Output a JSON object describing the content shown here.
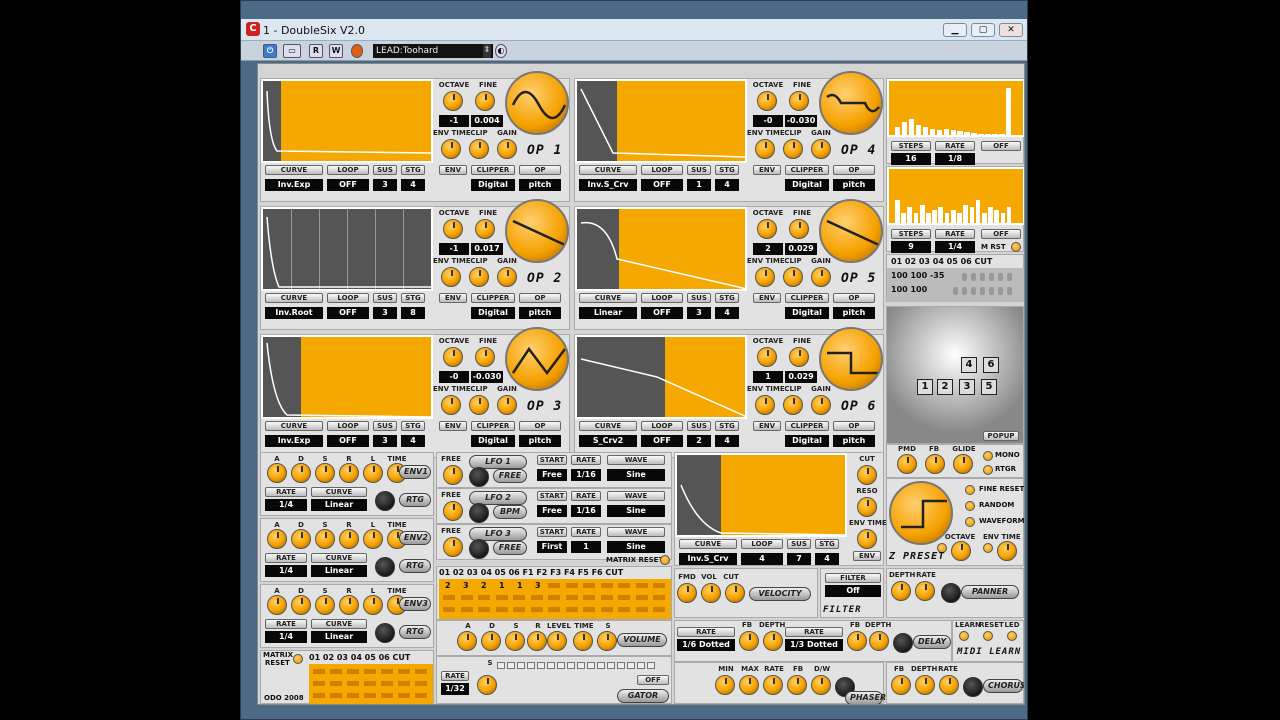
{
  "window": {
    "title": "1 - DoubleSix V2.0",
    "app_icon": "C"
  },
  "toolbar": {
    "preset": "LEAD:Toohard",
    "r": "R",
    "w": "W"
  },
  "ops": [
    {
      "name": "OP 1",
      "octave": "-1",
      "fine": "0.004",
      "curve": "Inv.Exp",
      "loop": "OFF",
      "sus": "3",
      "stg": "4",
      "clipper": "Digital",
      "op": "pitch",
      "wave": "sine"
    },
    {
      "name": "OP 2",
      "octave": "-1",
      "fine": "0.017",
      "curve": "Inv.Root",
      "loop": "OFF",
      "sus": "3",
      "stg": "8",
      "clipper": "Digital",
      "op": "pitch",
      "wave": "saw"
    },
    {
      "name": "OP 3",
      "octave": "-0",
      "fine": "-0.030",
      "curve": "Inv.Exp",
      "loop": "OFF",
      "sus": "3",
      "stg": "4",
      "clipper": "Digital",
      "op": "pitch",
      "wave": "tri"
    },
    {
      "name": "OP 4",
      "octave": "-0",
      "fine": "-0.030",
      "curve": "Inv.S_Crv",
      "loop": "OFF",
      "sus": "1",
      "stg": "4",
      "clipper": "Digital",
      "op": "pitch",
      "wave": "sq-sine"
    },
    {
      "name": "OP 5",
      "octave": "2",
      "fine": "0.029",
      "curve": "Linear",
      "loop": "OFF",
      "sus": "3",
      "stg": "4",
      "clipper": "Digital",
      "op": "pitch",
      "wave": "saw"
    },
    {
      "name": "OP 6",
      "octave": "1",
      "fine": "0.029",
      "curve": "S_Crv2",
      "loop": "OFF",
      "sus": "2",
      "stg": "4",
      "clipper": "Digital",
      "op": "pitch",
      "wave": "square"
    }
  ],
  "op_labels": {
    "octave": "OCTAVE",
    "fine": "FINE",
    "env_time": "ENV TIME",
    "clip": "CLIP",
    "gain": "GAIN",
    "curve": "CURVE",
    "loop": "LOOP",
    "sus": "SUS",
    "stg": "STG",
    "env": "ENV",
    "clipper": "CLIPPER",
    "op": "OP"
  },
  "seq1": {
    "steps_label": "STEPS",
    "rate_label": "RATE",
    "off": "OFF",
    "steps": "16",
    "rate": "1/8",
    "bars": [
      0.15,
      0.25,
      0.3,
      0.2,
      0.15,
      0.12,
      0.1,
      0.12,
      0.1,
      0.08,
      0.05,
      0.03,
      0.02,
      0.02,
      0.02,
      0.02,
      0.9
    ]
  },
  "seq2": {
    "steps_label": "STEPS",
    "rate_label": "RATE",
    "off": "OFF",
    "steps": "9",
    "rate": "1/4",
    "mrst": "M RST",
    "bars": [
      0.45,
      0.2,
      0.3,
      0.2,
      0.35,
      0.2,
      0.25,
      0.3,
      0.2,
      0.25,
      0.2,
      0.35,
      0.3,
      0.45,
      0.2,
      0.3,
      0.25,
      0.2,
      0.3
    ]
  },
  "route": {
    "header": "01 02 03 04 05 06 CUT",
    "row1": "100 100 -35",
    "row2": "100 100"
  },
  "algo": {
    "boxes": [
      "1",
      "2",
      "3",
      "5",
      "4",
      "6"
    ],
    "popup": "POPUP"
  },
  "global": {
    "pmd": "PMD",
    "fb": "FB",
    "glide": "GLIDE",
    "mono": "MONO",
    "rtgr": "RTGR"
  },
  "z": {
    "fine_reset": "FINE RESET",
    "random": "RANDOM",
    "waveform": "WAVEFORM",
    "octave": "OCTAVE",
    "env_time": "ENV TIME",
    "label": "Z PRESET"
  },
  "envs": [
    {
      "label": "ENV1",
      "rate": "1/4",
      "curve": "Linear"
    },
    {
      "label": "ENV2",
      "rate": "1/4",
      "curve": "Linear"
    },
    {
      "label": "ENV3",
      "rate": "1/4",
      "curve": "Linear"
    }
  ],
  "env_labels": {
    "a": "A",
    "d": "D",
    "s": "S",
    "r": "R",
    "l": "L",
    "time": "TIME",
    "rate": "RATE",
    "curve": "CURVE",
    "rtg": "RTG"
  },
  "lfos": [
    {
      "title": "LFO 1",
      "mode": "FREE",
      "start": "Free",
      "rate": "1/16",
      "wave": "Sine"
    },
    {
      "title": "LFO 2",
      "mode": "BPM",
      "start": "Free",
      "rate": "1/16",
      "wave": "Sine"
    },
    {
      "title": "LFO 3",
      "mode": "FREE",
      "start": "First",
      "rate": "1",
      "wave": "Sine"
    }
  ],
  "lfo_labels": {
    "free": "FREE",
    "start": "START",
    "rate": "RATE",
    "wave": "WAVE",
    "matrix_reset": "MATRIX RESET"
  },
  "fenv": {
    "cut": "CUT",
    "reso": "RESO",
    "env_time": "ENV TIME",
    "env": "ENV",
    "curve_label": "CURVE",
    "loop_label": "LOOP",
    "sus_label": "SUS",
    "stg_label": "STG",
    "curve": "Inv.S_Crv",
    "loop": "4",
    "sus": "7",
    "stg": "4"
  },
  "matrix": {
    "header": "01 02 03 04 05 06 F1 F2 F3 F4 F5 F6 CUT",
    "values": [
      "2",
      "3",
      "2",
      "1",
      "1",
      "3"
    ]
  },
  "velocity": {
    "fmd": "FMD",
    "vol": "VOL",
    "cut": "CUT",
    "label": "VELOCITY"
  },
  "filter": {
    "label": "FILTER",
    "value": "Off",
    "tag": "FILTER"
  },
  "panner": {
    "depth": "DEPTH",
    "rate": "RATE",
    "label": "PANNER"
  },
  "volume": {
    "a": "A",
    "d": "D",
    "s": "S",
    "r": "R",
    "level": "LEVEL",
    "time": "TIME",
    "s2": "S",
    "label": "VOLUME"
  },
  "delay": {
    "rate": "RATE",
    "fb": "FB",
    "depth": "DEPTH",
    "rate1": "1/6 Dotted",
    "rate2": "1/3 Dotted",
    "label": "DELAY"
  },
  "midi": {
    "learn": "LEARN",
    "reset": "RESET",
    "led": "LED",
    "label": "MIDI LEARN"
  },
  "matrix_reset": {
    "label1": "MATRIX",
    "label2": "RESET",
    "header": "01 02 03 04 05 06 CUT"
  },
  "gator": {
    "rate": "RATE",
    "value": "1/32",
    "s": "S",
    "off": "OFF",
    "label": "GATOR"
  },
  "phaser": {
    "min": "MIN",
    "max": "MAX",
    "rate": "RATE",
    "fb": "FB",
    "dw": "D/W",
    "label": "PHASER"
  },
  "chorus": {
    "fb": "FB",
    "depth": "DEPTH",
    "rate": "RATE",
    "label": "CHORUS"
  },
  "footer": "ODO 2008",
  "colors": {
    "accent": "#f5a800",
    "screen_dark": "#555555",
    "panel": "#d4d4d4"
  }
}
